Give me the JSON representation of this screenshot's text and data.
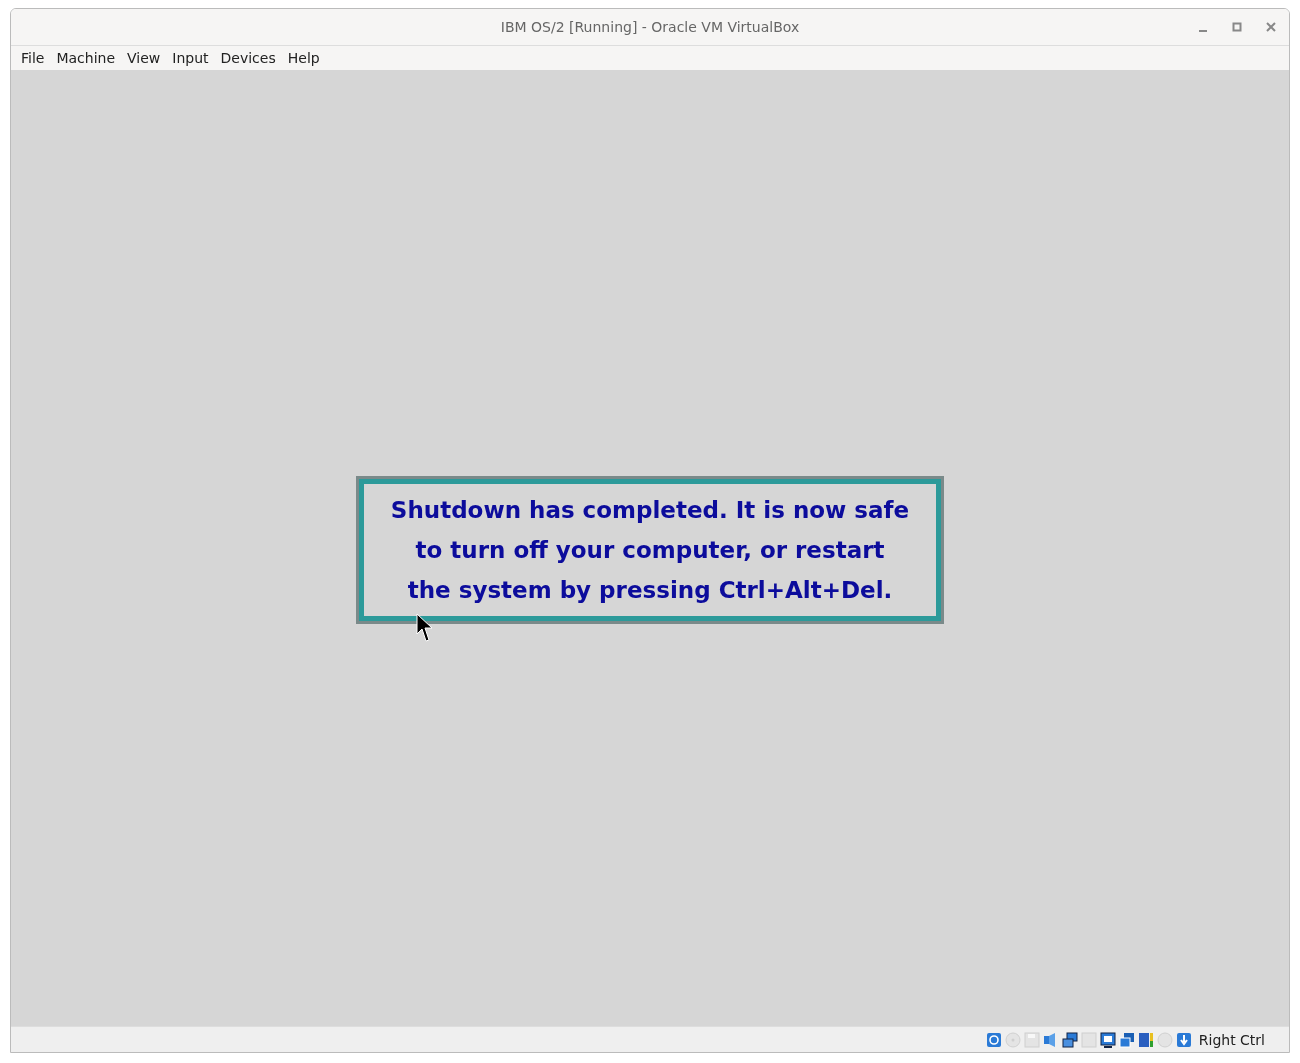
{
  "window": {
    "title": "IBM OS/2 [Running] - Oracle VM VirtualBox"
  },
  "menu": [
    "File",
    "Machine",
    "View",
    "Input",
    "Devices",
    "Help"
  ],
  "message": {
    "lines": [
      "Shutdown has completed. It is now safe",
      "to turn off your computer, or restart",
      "the system by pressing Ctrl+Alt+Del."
    ]
  },
  "status_bar": {
    "indicators": [
      {
        "kind": "disk",
        "disabled": false
      },
      {
        "kind": "optical",
        "disabled": true
      },
      {
        "kind": "floppy",
        "disabled": true
      },
      {
        "kind": "audio",
        "disabled": false
      },
      {
        "kind": "network",
        "disabled": false
      },
      {
        "kind": "usb",
        "disabled": true
      },
      {
        "kind": "display",
        "disabled": false
      },
      {
        "kind": "shared",
        "disabled": false
      },
      {
        "kind": "recording",
        "disabled": false
      },
      {
        "kind": "mouse",
        "disabled": true
      },
      {
        "kind": "keyboard",
        "disabled": false
      }
    ],
    "host_key": "Right Ctrl"
  }
}
